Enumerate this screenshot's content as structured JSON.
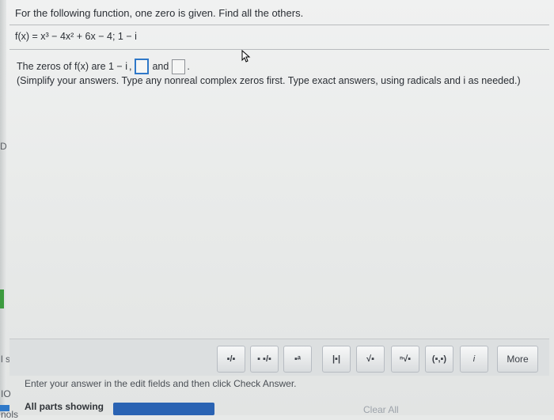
{
  "question": {
    "title": "For the following function, one zero is given. Find all the others.",
    "function_line": "f(x) = x³ − 4x² + 6x − 4; 1 − i",
    "answer_prefix": "The zeros of f(x) are 1 − i",
    "answer_separator": ",",
    "answer_connector": "and",
    "answer_suffix": ".",
    "instructions": "(Simplify your answers. Type any nonreal complex zeros first. Type exact answers, using radicals and i as needed.)"
  },
  "left_slices": {
    "top": "D",
    "mid1": "l sc",
    "mid2": "IO",
    "bottom": "nols"
  },
  "toolbar": {
    "buttons": [
      {
        "label": "▪/▪",
        "name": "fraction-button"
      },
      {
        "label": "▪ ▪/▪",
        "name": "mixed-number-button"
      },
      {
        "label": "▪ᵃ",
        "name": "exponent-button"
      },
      {
        "label": "|▪|",
        "name": "absolute-value-button"
      },
      {
        "label": "√▪",
        "name": "square-root-button"
      },
      {
        "label": "ⁿ√▪",
        "name": "nth-root-button"
      },
      {
        "label": "(▪,▪)",
        "name": "ordered-pair-button"
      },
      {
        "label": "i",
        "name": "imaginary-unit-button"
      },
      {
        "label": "More",
        "name": "more-button"
      }
    ]
  },
  "status": {
    "message": "Enter your answer in the edit fields and then click Check Answer.",
    "parts": "All parts showing",
    "clear_all": "Clear All"
  }
}
